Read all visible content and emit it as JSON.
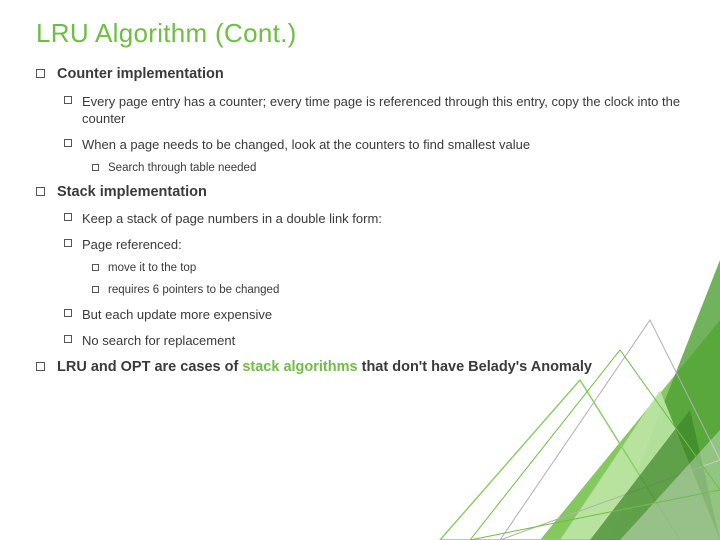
{
  "title": "LRU Algorithm (Cont.)",
  "items": {
    "counter": {
      "heading": "Counter implementation",
      "p1": "Every page entry has a counter; every time page is referenced through this entry, copy the clock into the counter",
      "p2": "When a page needs to be changed, look at the counters to find smallest value",
      "p2s1": "Search through table needed"
    },
    "stack": {
      "heading": "Stack implementation",
      "p1": "Keep a stack of page numbers in a double link form:",
      "p2": "Page referenced:",
      "p2s1": "move it to the top",
      "p2s2": "requires 6 pointers to be changed",
      "p3": "But each update more expensive",
      "p4": "No search for replacement"
    },
    "final": {
      "pre": "LRU and OPT are cases of ",
      "accent": "stack algorithms",
      "post": " that don't have Belady's Anomaly"
    }
  },
  "colors": {
    "accent": "#6fbe44"
  }
}
